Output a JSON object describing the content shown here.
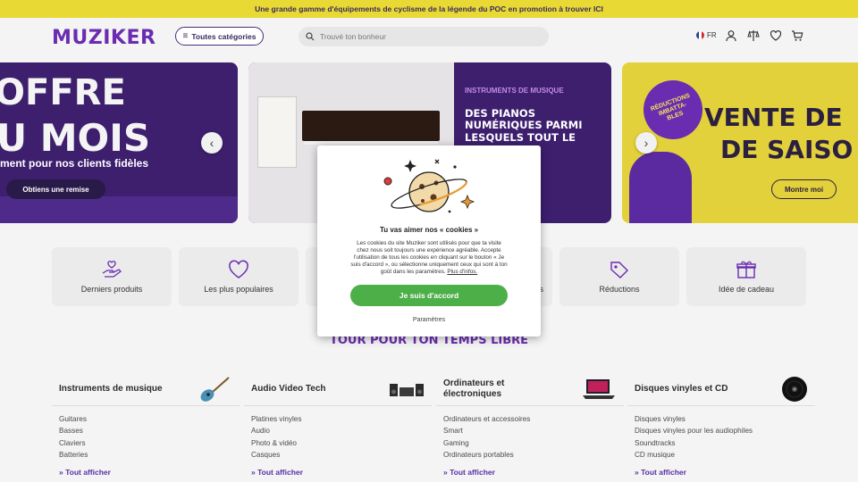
{
  "promo": {
    "text": "Une grande gamme d'équipements de cyclisme de la légende du POC en promotion à trouver ICI"
  },
  "header": {
    "logo": "MUZIKER",
    "categories_label": "Toutes catégories",
    "search_placeholder": "Trouvé ton bonheur",
    "lang": "FR",
    "icons": [
      "user-icon",
      "compare-icon",
      "heart-icon",
      "cart-icon"
    ]
  },
  "banners": {
    "left": {
      "line1": "OFFRE",
      "line2": "U MOIS",
      "subtitle": "ment pour nos clients fidèles",
      "button": "Obtiens une remise"
    },
    "mid": {
      "eyebrow": "INSTRUMENTS DE MUSIQUE",
      "headline": "DES PIANOS NUMÉRIQUES PARMI LESQUELS TOUT LE"
    },
    "right": {
      "badge": "RÉDUCTIONS IMBATTA-BLES",
      "line1": "VENTE DE",
      "line2": "DE SAISO",
      "button": "Montre moi"
    }
  },
  "categories": [
    {
      "label": "Derniers produits",
      "icon": "hand-heart-icon"
    },
    {
      "label": "Les plus populaires",
      "icon": "heart-icon"
    },
    {
      "label": "",
      "icon": ""
    },
    {
      "label": "s",
      "icon": ""
    },
    {
      "label": "Réductions",
      "icon": "tag-icon"
    },
    {
      "label": "Idée de cadeau",
      "icon": "gift-icon"
    }
  ],
  "section_title": "TOUR POUR TON TEMPS LIBRE",
  "columns": [
    {
      "title": "Instruments de musique",
      "items": [
        "Guitares",
        "Basses",
        "Claviers",
        "Batteries"
      ],
      "more": "Tout afficher",
      "icon": "guitar-icon"
    },
    {
      "title": "Audio Video Tech",
      "items": [
        "Platines vinyles",
        "Audio",
        "Photo & vidéo",
        "Casques"
      ],
      "more": "Tout afficher",
      "icon": "hifi-system-icon"
    },
    {
      "title": "Ordinateurs et électroniques",
      "items": [
        "Ordinateurs et accessoires",
        "Smart",
        "Gaming",
        "Ordinateurs portables"
      ],
      "more": "Tout afficher",
      "icon": "laptop-icon"
    },
    {
      "title": "Disques vinyles et CD",
      "items": [
        "Disques vinyles",
        "Disques vinyles pour les audiophiles",
        "Soundtracks",
        "CD musique"
      ],
      "more": "Tout afficher",
      "icon": "vinyl-record-icon"
    }
  ],
  "cookie_modal": {
    "title": "Tu vas aimer nos « cookies »",
    "text": "Les cookies du site Muziker sont utilisés pour que ta visite chez nous soit toujours une expérience agréable. Accepte l'utilisation de tous les cookies en cliquant sur le bouton « Je suis d'accord », ou sélectionne uniquement ceux qui sont à ton goût dans les paramètres.",
    "link": "Plus d'infos.",
    "accept": "Je suis d'accord",
    "settings": "Paramètres",
    "accent": "#4caf48"
  },
  "colors": {
    "brand": "#6a2cb1",
    "promo_bg": "#e9d934",
    "banner_purple": "#3d1f6e"
  }
}
